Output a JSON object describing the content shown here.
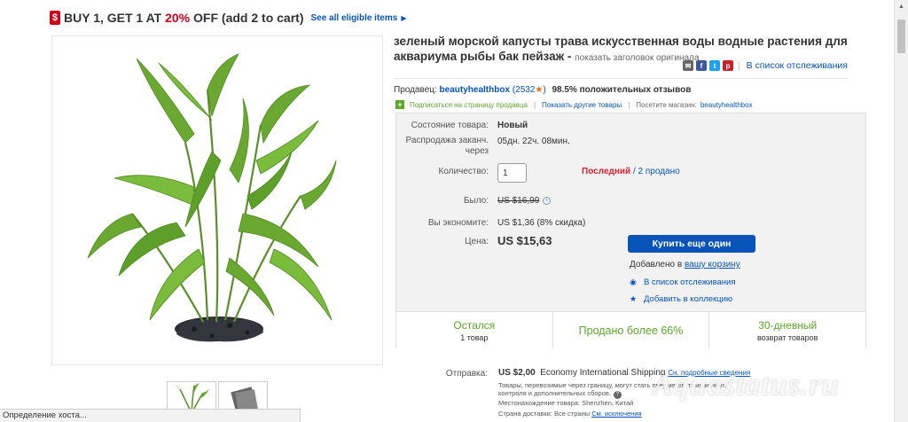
{
  "promo": {
    "text_pre": "BUY 1, GET 1 AT ",
    "percent": "20%",
    "text_post": " OFF (add 2 to cart)",
    "link": "See all eligible items",
    "badge": "$"
  },
  "title": {
    "main": "зеленый морской капусты трава искусственная воды водные растения для аквариума рыбы бак пейзаж - ",
    "original_link": "показать заголовок оригинала"
  },
  "share": {
    "icons": [
      "email-icon",
      "facebook-icon",
      "twitter-icon",
      "pinterest-icon"
    ],
    "separator": "|",
    "watch": "В список отслеживания"
  },
  "seller": {
    "label": "Продавец: ",
    "name": "beautyhealthbox",
    "score": "(2532",
    "score_close": ")",
    "positive": "98.5% положительных отзывов",
    "follow": "Подписаться на страницу продавца",
    "other": "Показать другие товары",
    "visit": "Посетите магазин:",
    "store": "beautyhealthbox"
  },
  "details": {
    "condition_label": "Состояние товара:",
    "condition": "Новый",
    "ends_label": "Распродажа заканч. через",
    "ends": "05дн. 22ч. 08мин.",
    "qty_label": "Количество:",
    "qty": "1",
    "last": "Последний",
    "sold": " / 2 продано",
    "was_label": "Было:",
    "was": "US $16,99",
    "save_label": "Вы экономите:",
    "save": "US $1,36 (8% скидка)",
    "price_label": "Цена:",
    "price": "US $15,63",
    "buy": "Купить еще один",
    "added_pre": "Добавлено в ",
    "added_link": "вашу корзину",
    "watchlist": "В список отслеживания",
    "collection": "Добавить в коллекцию"
  },
  "stats": {
    "left_main": "Остался",
    "left_sub": "1 товар",
    "mid_main": "Продано более 66%",
    "right_main": "30-дневный",
    "right_sub": "возврат товаров"
  },
  "shipping": {
    "label": "Отправка:",
    "price": "US $2,00",
    "method": "Economy International Shipping",
    "details": "Сн. подробные сведения",
    "note": "Товары, перевозимые через границу, могут стать предметом таможенного контроля и дополнительных сборов.",
    "location_label": "Местонахождение товара:",
    "location": "Shenzhen, Китай",
    "countries_label": "Страна доставки:",
    "countries": "Все страны",
    "exclusions": "См. исключения"
  },
  "status_bar": "Определение хоста...",
  "watermark": "Aquastatus.ru",
  "colors": {
    "accent": "#0654ba",
    "green": "#5ba829",
    "red": "#dd1e31"
  }
}
